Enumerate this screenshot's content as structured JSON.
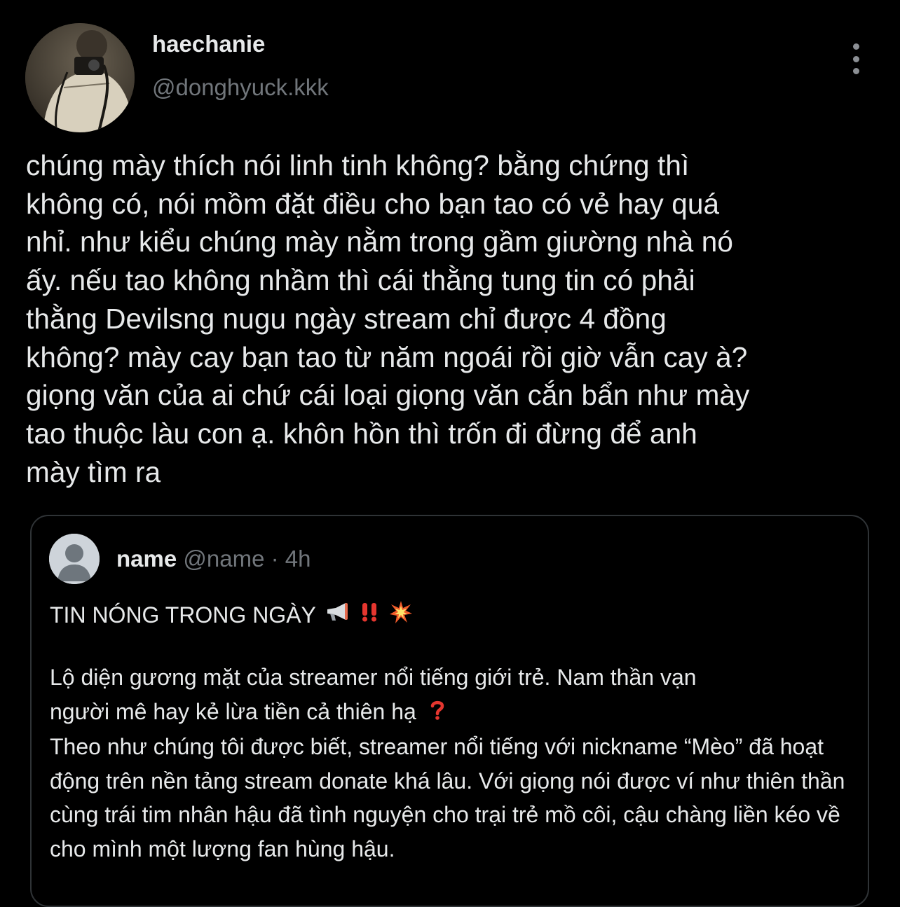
{
  "colors": {
    "background": "#000000",
    "primary_text": "#e7e9ea",
    "secondary_text": "#71767b",
    "border": "#2f3336",
    "default_avatar_bg": "#ced4da"
  },
  "tweet": {
    "author": {
      "display_name": "haechanie",
      "handle": "@donghyuck.kkk",
      "avatar_icon": "profile-photo"
    },
    "menu_icon": "more-vertical-icon",
    "text": "chúng mày thích nói linh tinh không? bằng chứng thì\nkhông có, nói mồm đặt điều cho bạn tao có vẻ hay quá\nnhỉ. như kiểu chúng mày nằm trong gầm giường nhà nó\nấy. nếu tao không nhầm thì cái thằng tung tin có phải\nthằng Devilsng nugu ngày stream chỉ được 4 đồng\nkhông? mày cay bạn tao từ năm ngoái rồi giờ vẫn cay à?\ngiọng văn của ai chứ cái loại giọng văn cắn bẩn như mày\ntao thuộc làu con ạ. khôn hồn thì trốn đi đừng để anh\nmày tìm ra"
  },
  "quoted_tweet": {
    "author": {
      "display_name": "name",
      "handle": "@name",
      "separator": "·",
      "time": "4h",
      "avatar_icon": "default-user-icon"
    },
    "headline": "TIN NÓNG TRONG NGÀY",
    "headline_emojis": [
      "📢",
      "‼️",
      "💥"
    ],
    "paragraph1_line1": "Lộ diện gương mặt của streamer nổi tiếng giới trẻ. Nam thần vạn",
    "paragraph1_line2": "người mê hay kẻ lừa tiền cả thiên hạ",
    "paragraph1_emoji": "❓",
    "paragraph2": "Theo như chúng tôi được biết, streamer nổi tiếng với nickname “Mèo” đã hoạt động trên nền tảng stream donate khá lâu. Với giọng nói được ví như thiên thần cùng trái tim nhân hậu đã tình nguyện cho trại trẻ mồ côi, cậu chàng liền kéo về cho mình một lượng fan hùng hậu."
  }
}
